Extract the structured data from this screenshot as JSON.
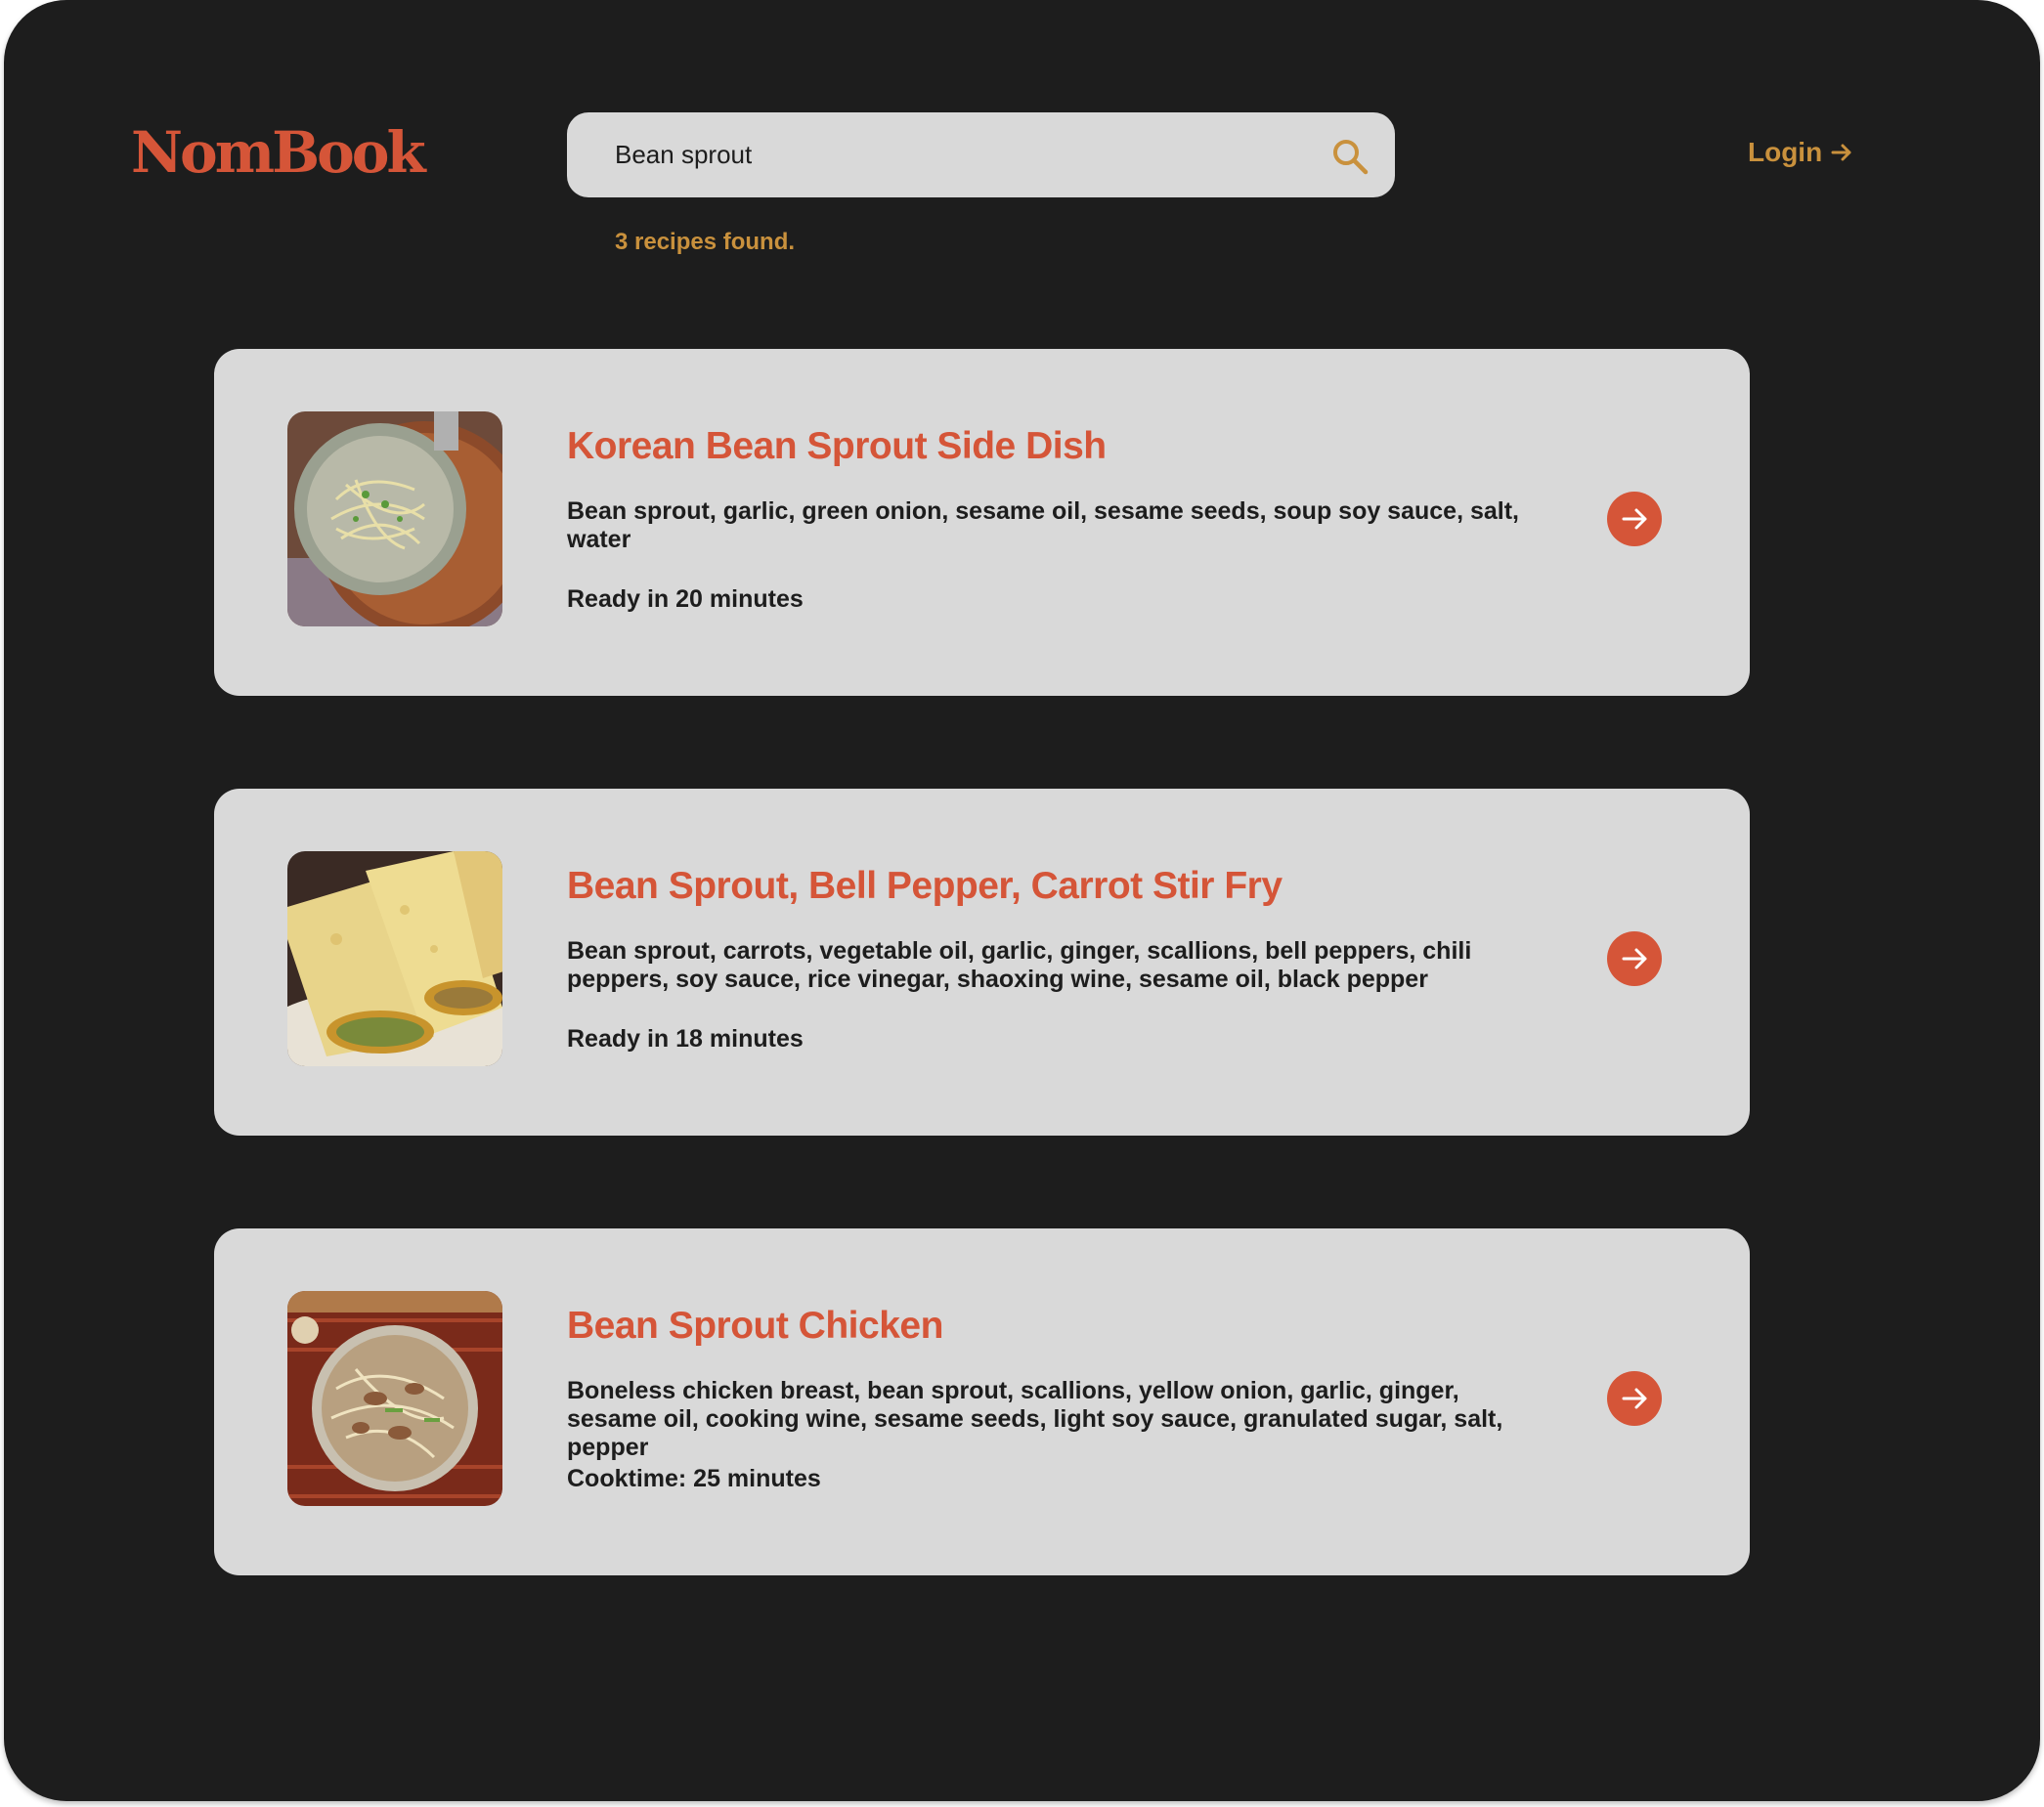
{
  "header": {
    "logo": "NomBook",
    "search": {
      "value": "Bean sprout",
      "icon": "search-icon"
    },
    "login_label": "Login"
  },
  "results_count": "3 recipes found.",
  "recipes": [
    {
      "title": "Korean Bean Sprout Side Dish",
      "ingredients": "Bean sprout, garlic, green onion, sesame oil, sesame seeds, soup soy sauce, salt, water",
      "time": "Ready in 20 minutes",
      "image": "korean-bean-sprout-side-dish-photo"
    },
    {
      "title": "Bean Sprout, Bell Pepper, Carrot Stir Fry",
      "ingredients": "Bean sprout, carrots, vegetable oil, garlic, ginger, scallions, bell peppers, chili peppers, soy sauce, rice vinegar, shaoxing wine, sesame oil, black pepper",
      "time": "Ready in 18 minutes",
      "image": "bean-sprout-stir-fry-wraps-photo"
    },
    {
      "title": "Bean Sprout Chicken",
      "ingredients": "Boneless chicken breast, bean sprout, scallions, yellow onion, garlic, ginger, sesame oil, cooking wine, sesame seeds, light soy sauce, granulated sugar, salt, pepper",
      "time": "Cooktime: 25 minutes",
      "image": "bean-sprout-chicken-photo"
    }
  ],
  "colors": {
    "background": "#1d1d1d",
    "card": "#d9d9d9",
    "accent_red": "#d55538",
    "accent_gold": "#c9913d"
  }
}
